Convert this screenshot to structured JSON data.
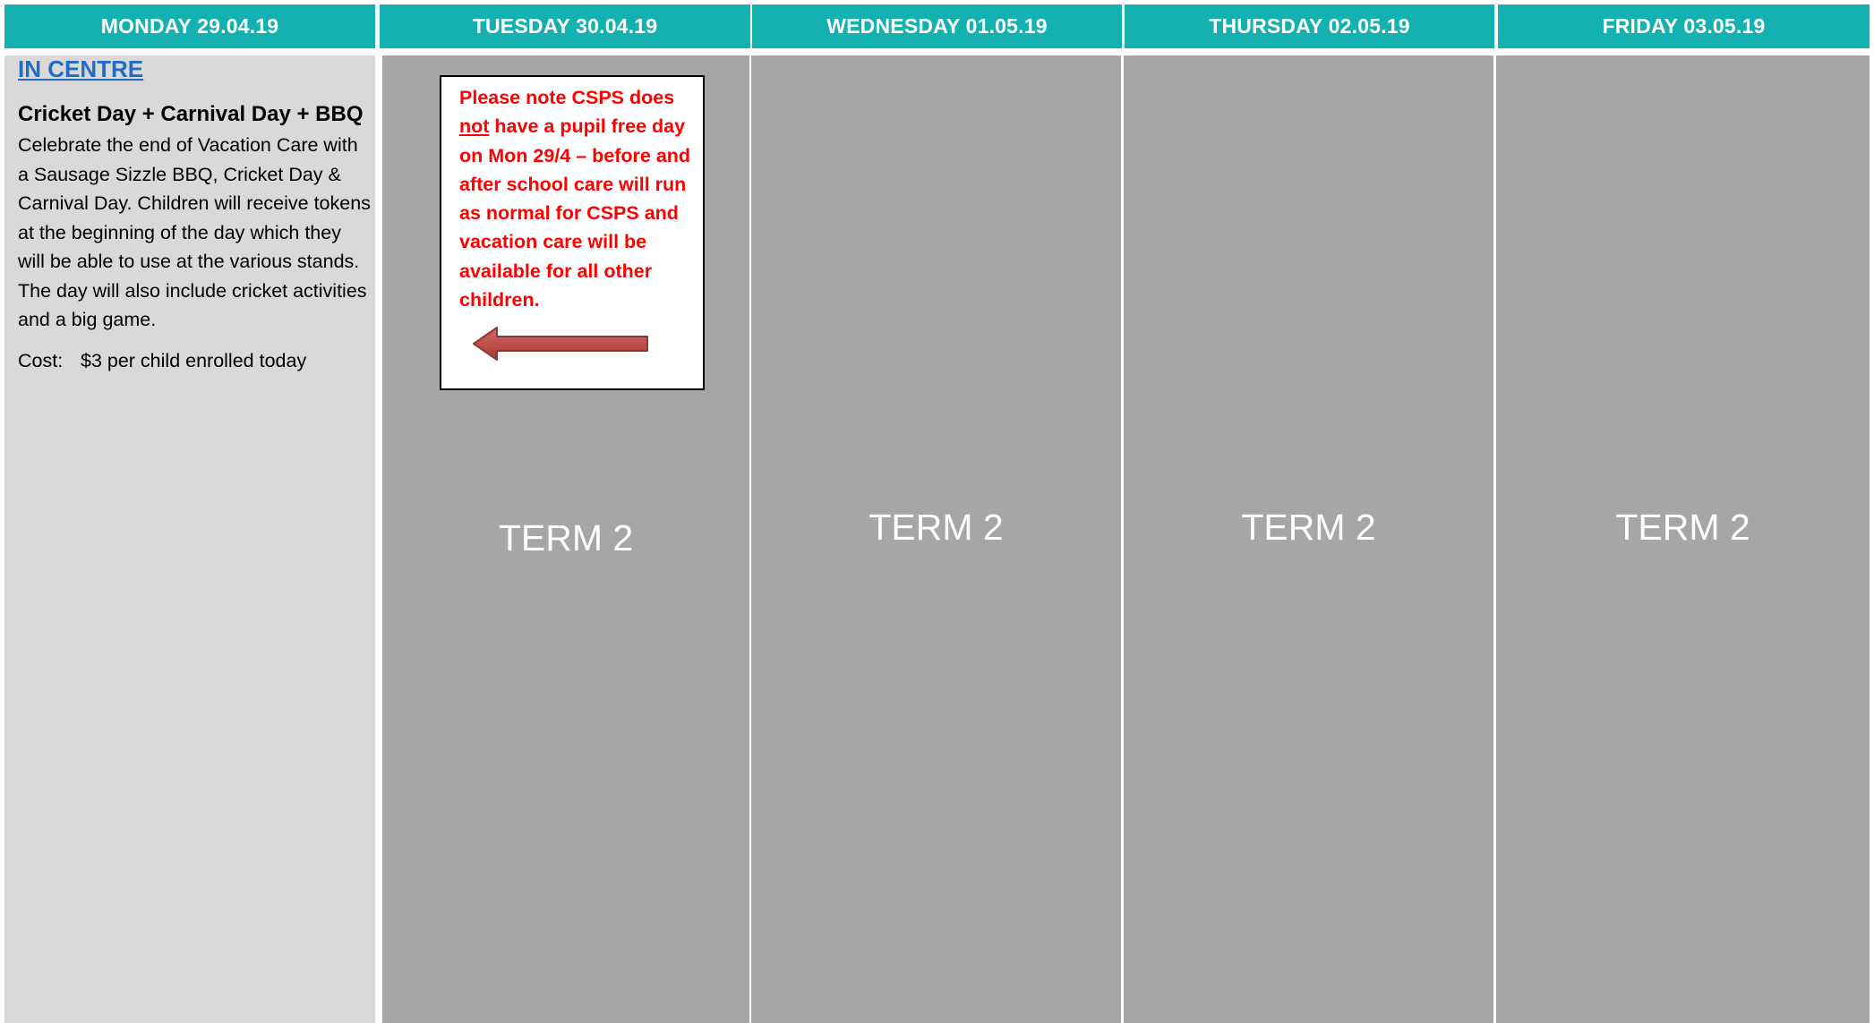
{
  "headers": [
    "MONDAY 29.04.19",
    "TUESDAY 30.04.19",
    "WEDNESDAY 01.05.19",
    "THURSDAY 02.05.19",
    "FRIDAY 03.05.19"
  ],
  "monday": {
    "location": "IN CENTRE",
    "event_title": "Cricket Day + Carnival Day + BBQ",
    "event_description": "Celebrate the end of Vacation Care with a Sausage Sizzle BBQ, Cricket Day & Carnival Day. Children will receive tokens at the beginning of the day which they will be able to use at the various stands. The day will also include cricket activities and a big game.",
    "cost_label": "Cost:",
    "cost_value": "$3 per child enrolled today"
  },
  "notice": {
    "text_before": "Please note CSPS does ",
    "text_underlined": "not",
    "text_after": " have a pupil free day on Mon 29/4 – before and after school care will run as normal for CSPS and vacation care will be available for all other children.",
    "arrow_direction": "left",
    "arrow_color": "#c0504d"
  },
  "term_labels": {
    "tuesday": "TERM 2",
    "wednesday": "TERM 2",
    "thursday": "TERM 2",
    "friday": "TERM 2"
  },
  "colors": {
    "header_bg": "#14b1b0",
    "monday_bg": "#d9d9d9",
    "term_bg": "#a6a6a6",
    "notice_text": "#ff0000",
    "link": "#1f6ec4"
  }
}
